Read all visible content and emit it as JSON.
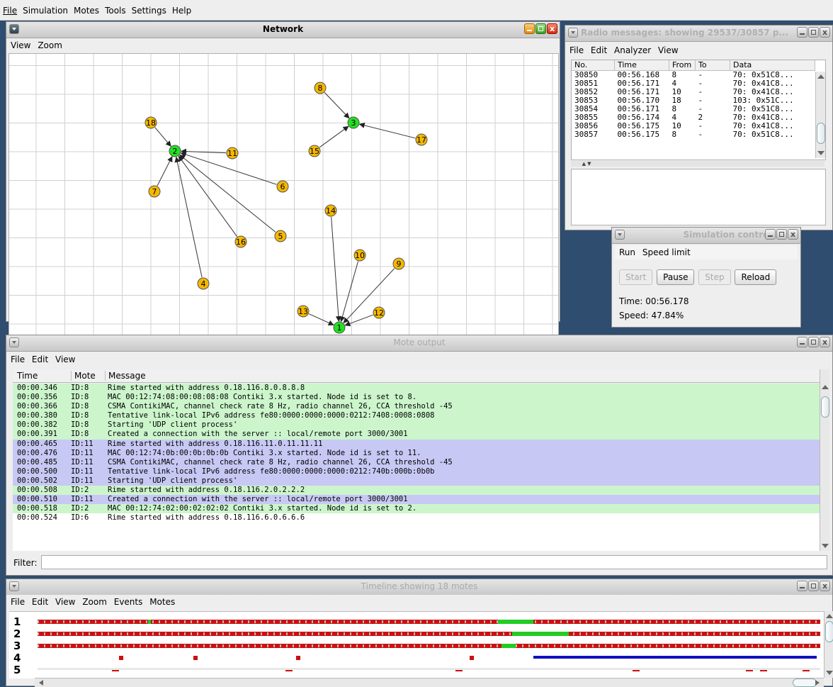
{
  "menubar": [
    "File",
    "Simulation",
    "Motes",
    "Tools",
    "Settings",
    "Help"
  ],
  "network": {
    "title": "Network",
    "menu": [
      "View",
      "Zoom"
    ],
    "nodes": [
      {
        "id": "1",
        "color": "#22e022"
      },
      {
        "id": "2",
        "color": "#22e022"
      },
      {
        "id": "3",
        "color": "#22e022"
      },
      {
        "id": "4",
        "color": "#f5b800"
      },
      {
        "id": "5",
        "color": "#f5b800"
      },
      {
        "id": "6",
        "color": "#f5b800"
      },
      {
        "id": "7",
        "color": "#f5b800"
      },
      {
        "id": "8",
        "color": "#f5b800"
      },
      {
        "id": "9",
        "color": "#f5b800"
      },
      {
        "id": "10",
        "color": "#f5b800"
      },
      {
        "id": "11",
        "color": "#f5b800"
      },
      {
        "id": "12",
        "color": "#f5b800"
      },
      {
        "id": "13",
        "color": "#f5b800"
      },
      {
        "id": "14",
        "color": "#f5b800"
      },
      {
        "id": "15",
        "color": "#f5b800"
      },
      {
        "id": "16",
        "color": "#f5b800"
      },
      {
        "id": "17",
        "color": "#f5b800"
      },
      {
        "id": "18",
        "color": "#f5b800"
      }
    ],
    "links": [
      [
        "18",
        "2"
      ],
      [
        "7",
        "2"
      ],
      [
        "11",
        "2"
      ],
      [
        "6",
        "2"
      ],
      [
        "5",
        "2"
      ],
      [
        "16",
        "2"
      ],
      [
        "4",
        "2"
      ],
      [
        "8",
        "3"
      ],
      [
        "15",
        "3"
      ],
      [
        "17",
        "3"
      ],
      [
        "14",
        "1"
      ],
      [
        "10",
        "1"
      ],
      [
        "9",
        "1"
      ],
      [
        "13",
        "1"
      ],
      [
        "12",
        "1"
      ]
    ]
  },
  "radio": {
    "title": "Radio messages: showing 29537/30857 p...",
    "menu": [
      "File",
      "Edit",
      "Analyzer",
      "View"
    ],
    "columns": [
      "No.",
      "Time",
      "From",
      "To",
      "Data"
    ],
    "rows": [
      [
        "30850",
        "00:56.168",
        "8",
        "-",
        "70: 0x51C8..."
      ],
      [
        "30851",
        "00:56.171",
        "4",
        "-",
        "70: 0x41C8..."
      ],
      [
        "30852",
        "00:56.171",
        "10",
        "-",
        "70: 0x41C8..."
      ],
      [
        "30853",
        "00:56.170",
        "18",
        "-",
        "103: 0x51C..."
      ],
      [
        "30854",
        "00:56.171",
        "8",
        "-",
        "70: 0x51C8..."
      ],
      [
        "30855",
        "00:56.174",
        "4",
        "2",
        "70: 0x41C8..."
      ],
      [
        "30856",
        "00:56.175",
        "10",
        "-",
        "70: 0x41C8..."
      ],
      [
        "30857",
        "00:56.175",
        "8",
        "-",
        "70: 0x51C8..."
      ]
    ]
  },
  "simcontrol": {
    "title": "Simulation control",
    "menu": [
      "Run",
      "Speed limit"
    ],
    "buttons": {
      "start": "Start",
      "pause": "Pause",
      "step": "Step",
      "reload": "Reload"
    },
    "time": "Time: 00:56.178",
    "speed": "Speed: 47.84%"
  },
  "moteoutput": {
    "title": "Mote output",
    "menu": [
      "File",
      "Edit",
      "View"
    ],
    "columns": [
      "Time",
      "Mote",
      "Message"
    ],
    "filter_label": "Filter:",
    "filter_value": "",
    "rows": [
      {
        "time": "00:00.346",
        "mote": "ID:8",
        "msg": "Rime started with address 0.18.116.8.0.8.8.8",
        "bg": "g"
      },
      {
        "time": "00:00.356",
        "mote": "ID:8",
        "msg": "MAC 00:12:74:08:00:08:08:08 Contiki 3.x started. Node id is set to 8.",
        "bg": "g"
      },
      {
        "time": "00:00.366",
        "mote": "ID:8",
        "msg": "CSMA ContikiMAC, channel check rate 8 Hz, radio channel 26, CCA threshold -45",
        "bg": "g"
      },
      {
        "time": "00:00.380",
        "mote": "ID:8",
        "msg": "Tentative link-local IPv6 address fe80:0000:0000:0000:0212:7408:0008:0808",
        "bg": "g"
      },
      {
        "time": "00:00.382",
        "mote": "ID:8",
        "msg": "Starting 'UDP client process'",
        "bg": "g"
      },
      {
        "time": "00:00.391",
        "mote": "ID:8",
        "msg": "Created a connection with the server :: local/remote port 3000/3001",
        "bg": "g"
      },
      {
        "time": "00:00.465",
        "mote": "ID:11",
        "msg": "Rime started with address 0.18.116.11.0.11.11.11",
        "bg": "b"
      },
      {
        "time": "00:00.476",
        "mote": "ID:11",
        "msg": "MAC 00:12:74:0b:00:0b:0b:0b Contiki 3.x started. Node id is set to 11.",
        "bg": "b"
      },
      {
        "time": "00:00.485",
        "mote": "ID:11",
        "msg": "CSMA ContikiMAC, channel check rate 8 Hz, radio channel 26, CCA threshold -45",
        "bg": "b"
      },
      {
        "time": "00:00.500",
        "mote": "ID:11",
        "msg": "Tentative link-local IPv6 address fe80:0000:0000:0000:0212:740b:000b:0b0b",
        "bg": "b"
      },
      {
        "time": "00:00.502",
        "mote": "ID:11",
        "msg": "Starting 'UDP client process'",
        "bg": "b"
      },
      {
        "time": "00:00.508",
        "mote": "ID:2",
        "msg": "Rime started with address 0.18.116.2.0.2.2.2",
        "bg": "g"
      },
      {
        "time": "00:00.510",
        "mote": "ID:11",
        "msg": "Created a connection with the server :: local/remote port 3000/3001",
        "bg": "b"
      },
      {
        "time": "00:00.518",
        "mote": "ID:2",
        "msg": "MAC 00:12:74:02:00:02:02:02 Contiki 3.x started. Node id is set to 2.",
        "bg": "g"
      },
      {
        "time": "00:00.524",
        "mote": "ID:6",
        "msg": "Rime started with address 0.18.116.6.0.6.6.6",
        "bg": "w"
      }
    ]
  },
  "timeline": {
    "title": "Timeline showing 18 motes",
    "menu": [
      "File",
      "Edit",
      "View",
      "Zoom",
      "Events",
      "Motes"
    ],
    "labels": [
      "1",
      "2",
      "3",
      "4",
      "5"
    ],
    "colors": {
      "tx": "#cc1010",
      "rx": "#22cc22",
      "idle": "#bbbbbb",
      "ipv6": "#1010c0"
    }
  }
}
